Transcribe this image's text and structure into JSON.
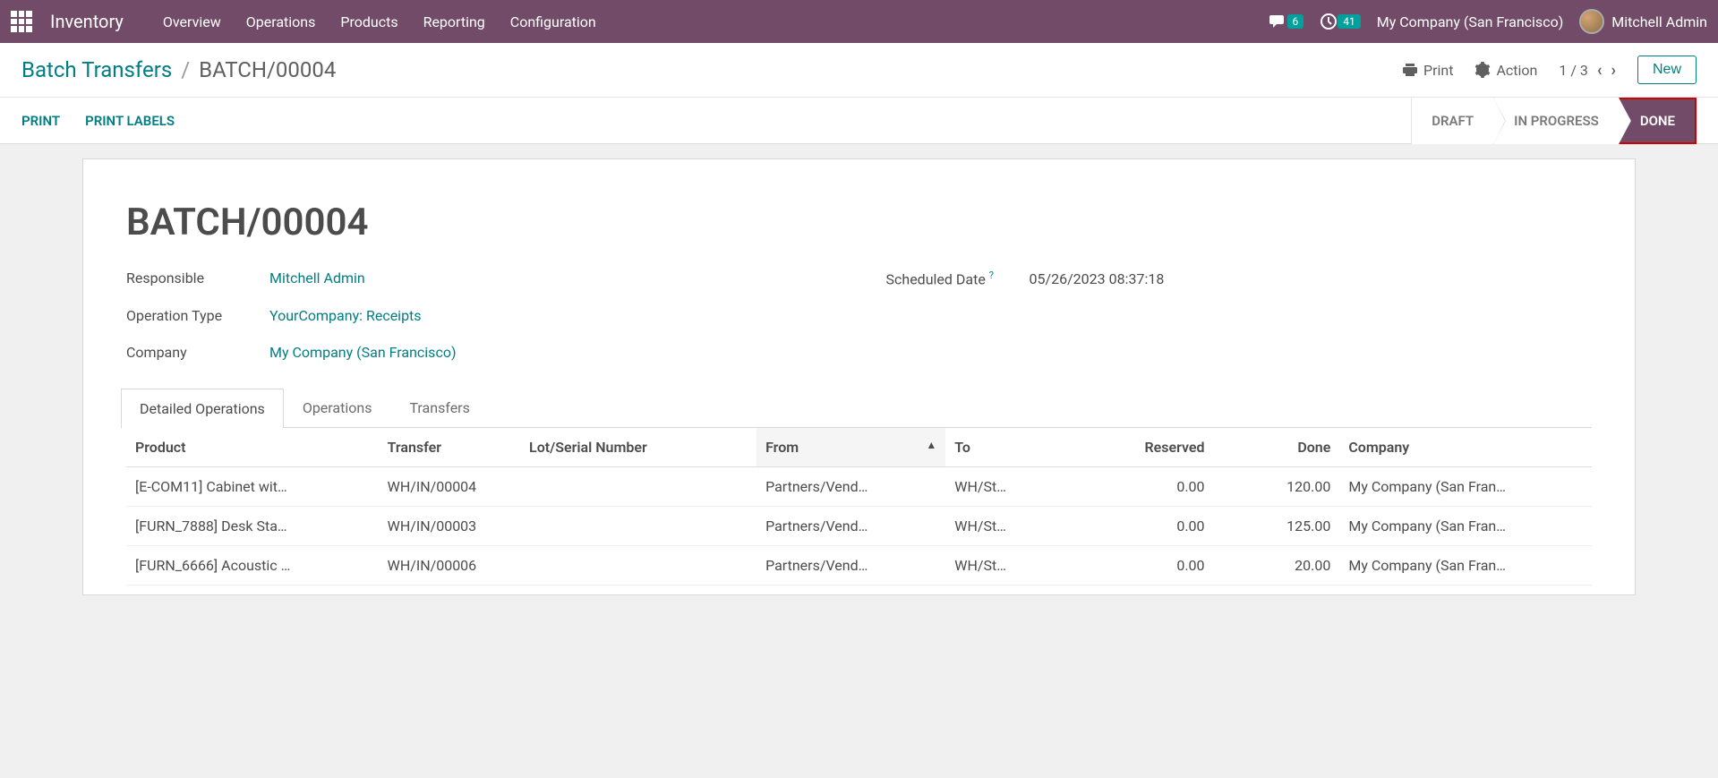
{
  "navbar": {
    "app_title": "Inventory",
    "menu": [
      "Overview",
      "Operations",
      "Products",
      "Reporting",
      "Configuration"
    ],
    "messages_badge": "6",
    "activities_badge": "41",
    "company": "My Company (San Francisco)",
    "user": "Mitchell Admin"
  },
  "breadcrumb": {
    "parent": "Batch Transfers",
    "current": "BATCH/00004"
  },
  "toolbar": {
    "print": "Print",
    "action": "Action",
    "pager": "1 / 3",
    "new": "New"
  },
  "actions": {
    "print": "PRINT",
    "print_labels": "PRINT LABELS"
  },
  "status": {
    "draft": "DRAFT",
    "in_progress": "IN PROGRESS",
    "done": "DONE"
  },
  "record": {
    "title": "BATCH/00004",
    "labels": {
      "responsible": "Responsible",
      "operation_type": "Operation Type",
      "company": "Company",
      "scheduled_date": "Scheduled Date"
    },
    "responsible": "Mitchell Admin",
    "operation_type": "YourCompany: Receipts",
    "company": "My Company (San Francisco)",
    "scheduled_date": "05/26/2023 08:37:18"
  },
  "tabs": {
    "detailed_operations": "Detailed Operations",
    "operations": "Operations",
    "transfers": "Transfers"
  },
  "table": {
    "headers": {
      "product": "Product",
      "transfer": "Transfer",
      "lot": "Lot/Serial Number",
      "from": "From",
      "to": "To",
      "reserved": "Reserved",
      "done": "Done",
      "company": "Company"
    },
    "rows": [
      {
        "product": "[E-COM11] Cabinet wit…",
        "transfer": "WH/IN/00004",
        "lot": "",
        "from": "Partners/Vend…",
        "to": "WH/St…",
        "reserved": "0.00",
        "done": "120.00",
        "company": "My Company (San Fran…"
      },
      {
        "product": "[FURN_7888] Desk Sta…",
        "transfer": "WH/IN/00003",
        "lot": "",
        "from": "Partners/Vend…",
        "to": "WH/St…",
        "reserved": "0.00",
        "done": "125.00",
        "company": "My Company (San Fran…"
      },
      {
        "product": "[FURN_6666] Acoustic …",
        "transfer": "WH/IN/00006",
        "lot": "",
        "from": "Partners/Vend…",
        "to": "WH/St…",
        "reserved": "0.00",
        "done": "20.00",
        "company": "My Company (San Fran…"
      }
    ]
  }
}
